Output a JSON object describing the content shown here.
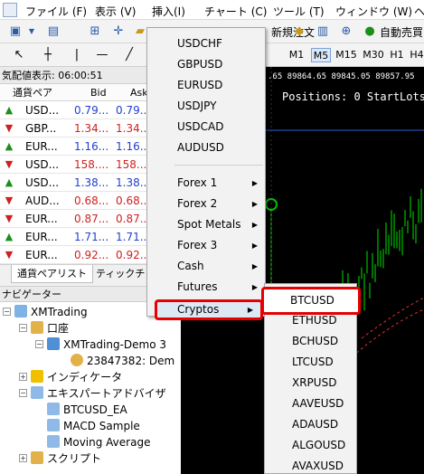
{
  "menubar": {
    "items": [
      "ファイル (F)",
      "表示 (V)",
      "挿入(I)",
      "チャート (C)",
      "ツール (T)",
      "ウィンドウ (W)",
      "ヘ"
    ]
  },
  "toolbar": {
    "new_order_label": "新規注文",
    "auto_trade_label": "自動売買"
  },
  "timeframes": [
    "M1",
    "M5",
    "M15",
    "M30",
    "H1",
    "H4"
  ],
  "market_watch": {
    "title": "気配値表示: 06:00:51",
    "col_symbol": "通貨ペア",
    "col_bid": "Bid",
    "col_ask": "Ask",
    "rows": [
      {
        "symbol": "USD...",
        "bid": "0.79...",
        "ask": "0.79...",
        "dir": "up"
      },
      {
        "symbol": "GBP...",
        "bid": "1.34...",
        "ask": "1.34...",
        "dir": "down"
      },
      {
        "symbol": "EUR...",
        "bid": "1.16...",
        "ask": "1.16...",
        "dir": "up"
      },
      {
        "symbol": "USD...",
        "bid": "158....",
        "ask": "158....",
        "dir": "down"
      },
      {
        "symbol": "USD...",
        "bid": "1.38...",
        "ask": "1.38...",
        "dir": "up"
      },
      {
        "symbol": "AUD...",
        "bid": "0.68...",
        "ask": "0.68...",
        "dir": "down"
      },
      {
        "symbol": "EUR...",
        "bid": "0.87...",
        "ask": "0.87...",
        "dir": "down"
      },
      {
        "symbol": "EUR...",
        "bid": "1.71...",
        "ask": "1.71...",
        "dir": "up"
      },
      {
        "symbol": "EUR...",
        "bid": "0.92...",
        "ask": "0.92...",
        "dir": "down"
      }
    ],
    "tab_pairs": "通貨ペアリスト",
    "tab_tick": "ティックチャー"
  },
  "navigator": {
    "title": "ナビゲーター",
    "root": "XMTrading",
    "accounts": "口座",
    "account_server": "XMTrading-Demo 3",
    "account_id": "23847382: Dem",
    "indicators": "インディケータ",
    "experts": "エキスパートアドバイザ",
    "ea1": "BTCUSD_EA",
    "ea2": "MACD Sample",
    "ea3": "Moving Average",
    "scripts": "スクリプト"
  },
  "chart": {
    "info_line": ".65 89864.65 89845.05 89857.95",
    "positions_text": "Positions: 0 StartLots("
  },
  "dropdown": {
    "symbols": [
      "USDCHF",
      "GBPUSD",
      "EURUSD",
      "USDJPY",
      "USDCAD",
      "AUDUSD"
    ],
    "groups": [
      "Forex 1",
      "Forex 2",
      "Spot Metals",
      "Forex 3",
      "Cash",
      "Futures",
      "Cryptos"
    ]
  },
  "cryptos_submenu": [
    "BTCUSD",
    "ETHUSD",
    "BCHUSD",
    "LTCUSD",
    "XRPUSD",
    "AAVEUSD",
    "ADAUSD",
    "ALGOUSD",
    "AVAXUSD"
  ],
  "colors": {
    "up": "#1a8f1a",
    "down": "#d11f1f",
    "bid_blue": "#1f3fd1",
    "highlight_red": "#e60000",
    "candle_green": "#00e000"
  }
}
